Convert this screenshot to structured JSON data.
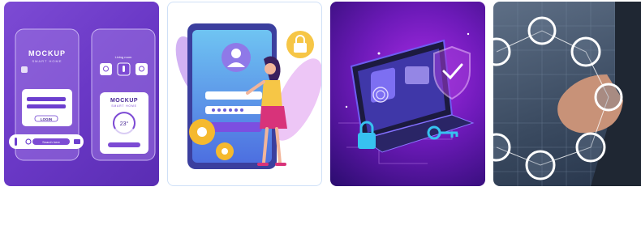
{
  "tiles": [
    {
      "label": "mockup-smart-home",
      "phone_left": {
        "title": "MOCKUP",
        "subtitle": "SMART HOME",
        "button": "LOGIN",
        "search": "Search here"
      },
      "phone_right": {
        "header": "Living room",
        "title": "MOCKUP",
        "subtitle": "SMART HOME",
        "temperature": "23°"
      }
    },
    {
      "label": "login-illustration"
    },
    {
      "label": "laptop-security"
    },
    {
      "label": "touch-network"
    }
  ]
}
